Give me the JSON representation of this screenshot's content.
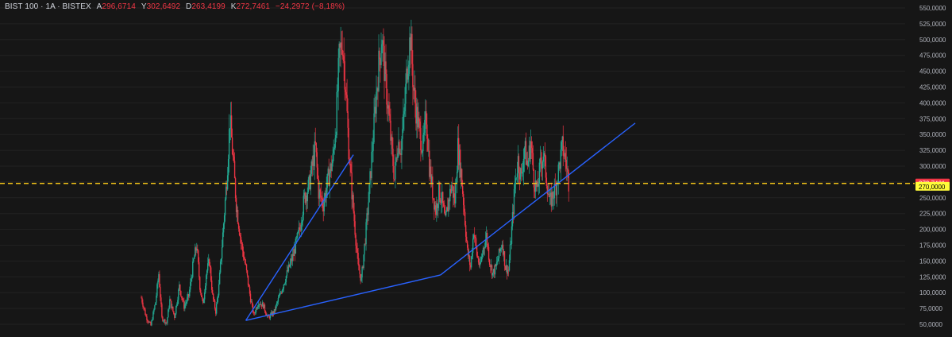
{
  "header": {
    "symbol": "BIST 100 · 1A · BISTEX",
    "open_key": "A",
    "open": "296,6714",
    "high_key": "Y",
    "high": "302,6492",
    "low_key": "D",
    "low": "263,4199",
    "close_key": "K",
    "close": "272,7461",
    "change": "−24,2972 (−8,18%)"
  },
  "colors": {
    "background": "#161616",
    "up": "#22ab94",
    "down": "#f23645",
    "trendline": "#2962ff",
    "hline": "#f5c518",
    "price_badge": "#f23645",
    "level_badge": "#fffb3a"
  },
  "chart_data": {
    "type": "candlestick",
    "y_axis": {
      "ticks": [
        "550,0000",
        "525,0000",
        "500,0000",
        "475,0000",
        "450,0000",
        "425,0000",
        "400,0000",
        "375,0000",
        "350,0000",
        "325,0000",
        "300,0000",
        "275,0000",
        "250,0000",
        "225,0000",
        "200,0000",
        "175,0000",
        "150,0000",
        "125,0000",
        "100,0000",
        "75,0000",
        "50,0000"
      ],
      "tick_values": [
        550,
        525,
        500,
        475,
        450,
        425,
        400,
        375,
        350,
        325,
        300,
        275,
        250,
        225,
        200,
        175,
        150,
        125,
        100,
        75,
        50
      ],
      "ylim": [
        37,
        562
      ]
    },
    "last_price": {
      "value": 272.7461,
      "label": "272,7461"
    },
    "horizontal_level": {
      "value": 270,
      "label": "270,0000"
    },
    "price_path": [
      [
        0,
        92
      ],
      [
        3,
        62
      ],
      [
        6,
        48
      ],
      [
        9,
        85
      ],
      [
        11,
        130
      ],
      [
        13,
        60
      ],
      [
        16,
        52
      ],
      [
        18,
        88
      ],
      [
        21,
        62
      ],
      [
        24,
        110
      ],
      [
        27,
        78
      ],
      [
        30,
        95
      ],
      [
        33,
        150
      ],
      [
        35,
        175
      ],
      [
        37,
        110
      ],
      [
        39,
        80
      ],
      [
        41,
        130
      ],
      [
        43,
        150
      ],
      [
        45,
        95
      ],
      [
        47,
        70
      ],
      [
        49,
        110
      ],
      [
        51,
        175
      ],
      [
        54,
        280
      ],
      [
        56,
        375
      ],
      [
        58,
        310
      ],
      [
        60,
        240
      ],
      [
        63,
        180
      ],
      [
        66,
        140
      ],
      [
        69,
        90
      ],
      [
        71,
        65
      ],
      [
        74,
        85
      ],
      [
        77,
        80
      ],
      [
        80,
        60
      ],
      [
        84,
        70
      ],
      [
        88,
        100
      ],
      [
        92,
        130
      ],
      [
        96,
        160
      ],
      [
        100,
        200
      ],
      [
        103,
        250
      ],
      [
        106,
        270
      ],
      [
        110,
        330
      ],
      [
        112,
        260
      ],
      [
        115,
        240
      ],
      [
        118,
        280
      ],
      [
        121,
        310
      ],
      [
        123,
        370
      ],
      [
        125,
        470
      ],
      [
        127,
        500
      ],
      [
        129,
        430
      ],
      [
        131,
        330
      ],
      [
        133,
        260
      ],
      [
        135,
        200
      ],
      [
        137,
        140
      ],
      [
        139,
        120
      ],
      [
        142,
        200
      ],
      [
        144,
        260
      ],
      [
        146,
        330
      ],
      [
        148,
        400
      ],
      [
        150,
        460
      ],
      [
        152,
        505
      ],
      [
        154,
        440
      ],
      [
        156,
        390
      ],
      [
        158,
        330
      ],
      [
        160,
        280
      ],
      [
        162,
        340
      ],
      [
        164,
        330
      ],
      [
        166,
        380
      ],
      [
        168,
        460
      ],
      [
        170,
        505
      ],
      [
        172,
        420
      ],
      [
        174,
        380
      ],
      [
        176,
        350
      ],
      [
        178,
        330
      ],
      [
        180,
        380
      ],
      [
        182,
        300
      ],
      [
        184,
        260
      ],
      [
        186,
        230
      ],
      [
        188,
        260
      ],
      [
        190,
        245
      ],
      [
        192,
        210
      ],
      [
        194,
        245
      ],
      [
        196,
        270
      ],
      [
        198,
        245
      ],
      [
        200,
        330
      ],
      [
        202,
        290
      ],
      [
        204,
        230
      ],
      [
        206,
        165
      ],
      [
        208,
        140
      ],
      [
        210,
        200
      ],
      [
        212,
        160
      ],
      [
        214,
        140
      ],
      [
        216,
        170
      ],
      [
        218,
        190
      ],
      [
        220,
        150
      ],
      [
        222,
        130
      ],
      [
        224,
        140
      ],
      [
        226,
        160
      ],
      [
        228,
        180
      ],
      [
        230,
        140
      ],
      [
        232,
        135
      ],
      [
        234,
        200
      ],
      [
        236,
        270
      ],
      [
        238,
        310
      ],
      [
        240,
        280
      ],
      [
        242,
        330
      ],
      [
        244,
        300
      ],
      [
        246,
        340
      ],
      [
        248,
        280
      ],
      [
        250,
        260
      ],
      [
        252,
        300
      ],
      [
        254,
        320
      ],
      [
        256,
        280
      ],
      [
        258,
        240
      ],
      [
        260,
        255
      ],
      [
        262,
        270
      ],
      [
        264,
        300
      ],
      [
        266,
        330
      ],
      [
        268,
        310
      ],
      [
        270,
        275
      ]
    ],
    "trendlines": [
      {
        "from": [
          66,
          56
        ],
        "to": [
          134,
          318
        ]
      },
      {
        "from": [
          66,
          56
        ],
        "to": [
          189,
          128
        ]
      },
      {
        "from": [
          189,
          128
        ],
        "to": [
          312,
          368
        ]
      }
    ],
    "x_range": [
      -4,
      312
    ]
  }
}
